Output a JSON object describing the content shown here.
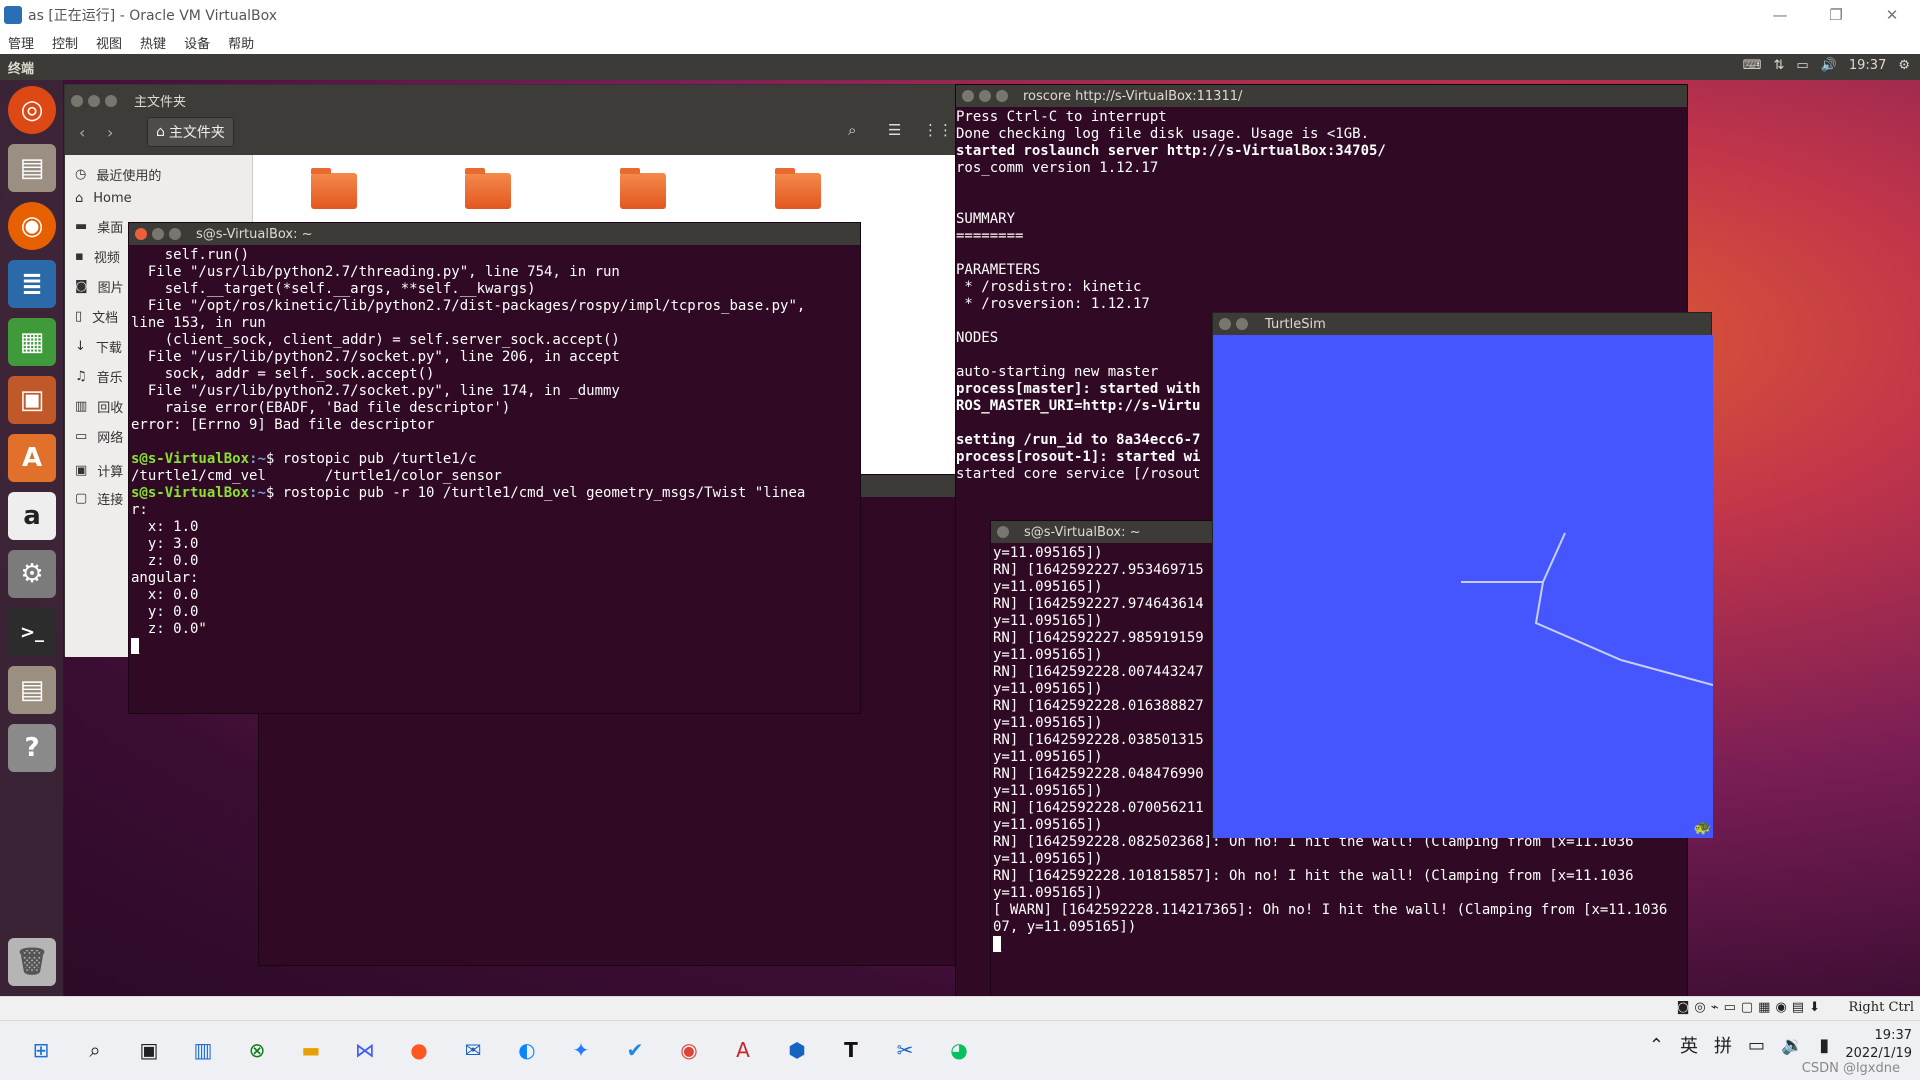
{
  "window": {
    "title": "as [正在运行] - Oracle VM VirtualBox",
    "minimize": "—",
    "restore": "❐",
    "close": "✕"
  },
  "menu": [
    "管理",
    "控制",
    "视图",
    "热键",
    "设备",
    "帮助"
  ],
  "guest_topbar": {
    "app": "终端",
    "time": "19:37"
  },
  "nautilus": {
    "title": "主文件夹",
    "path_button": "主文件夹",
    "sidebar": [
      "最近使用的",
      "Home",
      "桌面",
      "视频",
      "图片",
      "文档",
      "下载",
      "音乐",
      "回收",
      "网络",
      "计算",
      "连接"
    ]
  },
  "term1": {
    "title": "s@s-VirtualBox: ~",
    "lines_before": "    self.run()\n  File \"/usr/lib/python2.7/threading.py\", line 754, in run\n    self.__target(*self.__args, **self.__kwargs)\n  File \"/opt/ros/kinetic/lib/python2.7/dist-packages/rospy/impl/tcpros_base.py\",\nline 153, in run\n    (client_sock, client_addr) = self.server_sock.accept()\n  File \"/usr/lib/python2.7/socket.py\", line 206, in accept\n    sock, addr = self._sock.accept()\n  File \"/usr/lib/python2.7/socket.py\", line 174, in _dummy\n    raise error(EBADF, 'Bad file descriptor')\nerror: [Errno 9] Bad file descriptor\n",
    "prompt_user": "s@s-VirtualBox",
    "prompt_path": ":~",
    "cmd1": "$ rostopic pub /turtle1/c",
    "completion": "/turtle1/cmd_vel       /turtle1/color_sensor",
    "cmd2": "$ rostopic pub -r 10 /turtle1/cmd_vel geometry_msgs/Twist \"linea",
    "lines_after": "r:\n  x: 1.0\n  y: 3.0\n  z: 0.0\nangular:\n  x: 0.0\n  y: 0.0\n  z: 0.0\""
  },
  "roscore": {
    "title": "roscore http://s-VirtualBox:11311/",
    "l1": "Press Ctrl-C to interrupt\nDone checking log file disk usage. Usage is <1GB.\n",
    "l2": "started roslaunch server http://s-VirtualBox:34705/",
    "l3": "ros_comm version 1.12.17\n\n\nSUMMARY\n========\n\nPARAMETERS\n * /rosdistro: kinetic\n * /rosversion: 1.12.17\n\nNODES\n\nauto-starting new master",
    "l4": "process[master]: started with\nROS_MASTER_URI=http://s-Virtu",
    "l5": "setting /run_id to 8a34ecc6-7\nprocess[rosout-1]: started wi",
    "l6": "started core service [/rosout"
  },
  "term3": {
    "title": "s@s-VirtualBox: ~",
    "log": "y=11.095165])\nRN] [1642592227.953469715\ny=11.095165])\nRN] [1642592227.974643614\ny=11.095165])\nRN] [1642592227.985919159\ny=11.095165])\nRN] [1642592228.007443247\ny=11.095165])\nRN] [1642592228.016388827\ny=11.095165])\nRN] [1642592228.038501315\ny=11.095165])\nRN] [1642592228.048476990\ny=11.095165])\nRN] [1642592228.070056211\ny=11.095165])",
    "bottom": "RN] [1642592228.082502368]: Oh no! I hit the wall! (Clamping from [x=11.1036\ny=11.095165])\nRN] [1642592228.101815857]: Oh no! I hit the wall! (Clamping from [x=11.1036\ny=11.095165])\n[ WARN] [1642592228.114217365]: Oh no! I hit the wall! (Clamping from [x=11.1036\n07, y=11.095165])"
  },
  "turtlesim": {
    "title": "TurtleSim",
    "bg": "#4556ff"
  },
  "vbstatus": {
    "hostkey": "Right Ctrl"
  },
  "taskbar": {
    "lang": "英",
    "ime": "拼",
    "time": "19:37",
    "date": "2022/1/19",
    "watermark": "CSDN @lgxdne"
  }
}
